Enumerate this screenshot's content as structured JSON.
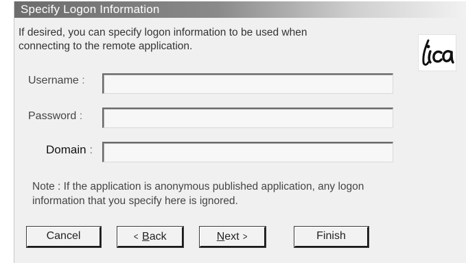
{
  "dialog": {
    "title": "Specify Logon Information",
    "intro_line1": "If desired, you can specify logon information to be used when",
    "intro_line2": "connecting to the remote application.",
    "logo_icon": "ica-logo"
  },
  "fields": {
    "username": {
      "label": "Username",
      "colon": " :",
      "value": ""
    },
    "password": {
      "label": "Password",
      "colon": " :",
      "value": ""
    },
    "domain": {
      "label": "Domain",
      "colon": " :",
      "value": ""
    }
  },
  "note": {
    "line1": "Note : If the application is anonymous published application, any logon",
    "line2": "information that you specify here is ignored."
  },
  "buttons": {
    "cancel": "Cancel",
    "back_chevron": "<",
    "back_mnemonic": "B",
    "back_rest": "ack",
    "next_mnemonic": "N",
    "next_rest": "ext",
    "next_chevron": ">",
    "finish": "Finish"
  }
}
